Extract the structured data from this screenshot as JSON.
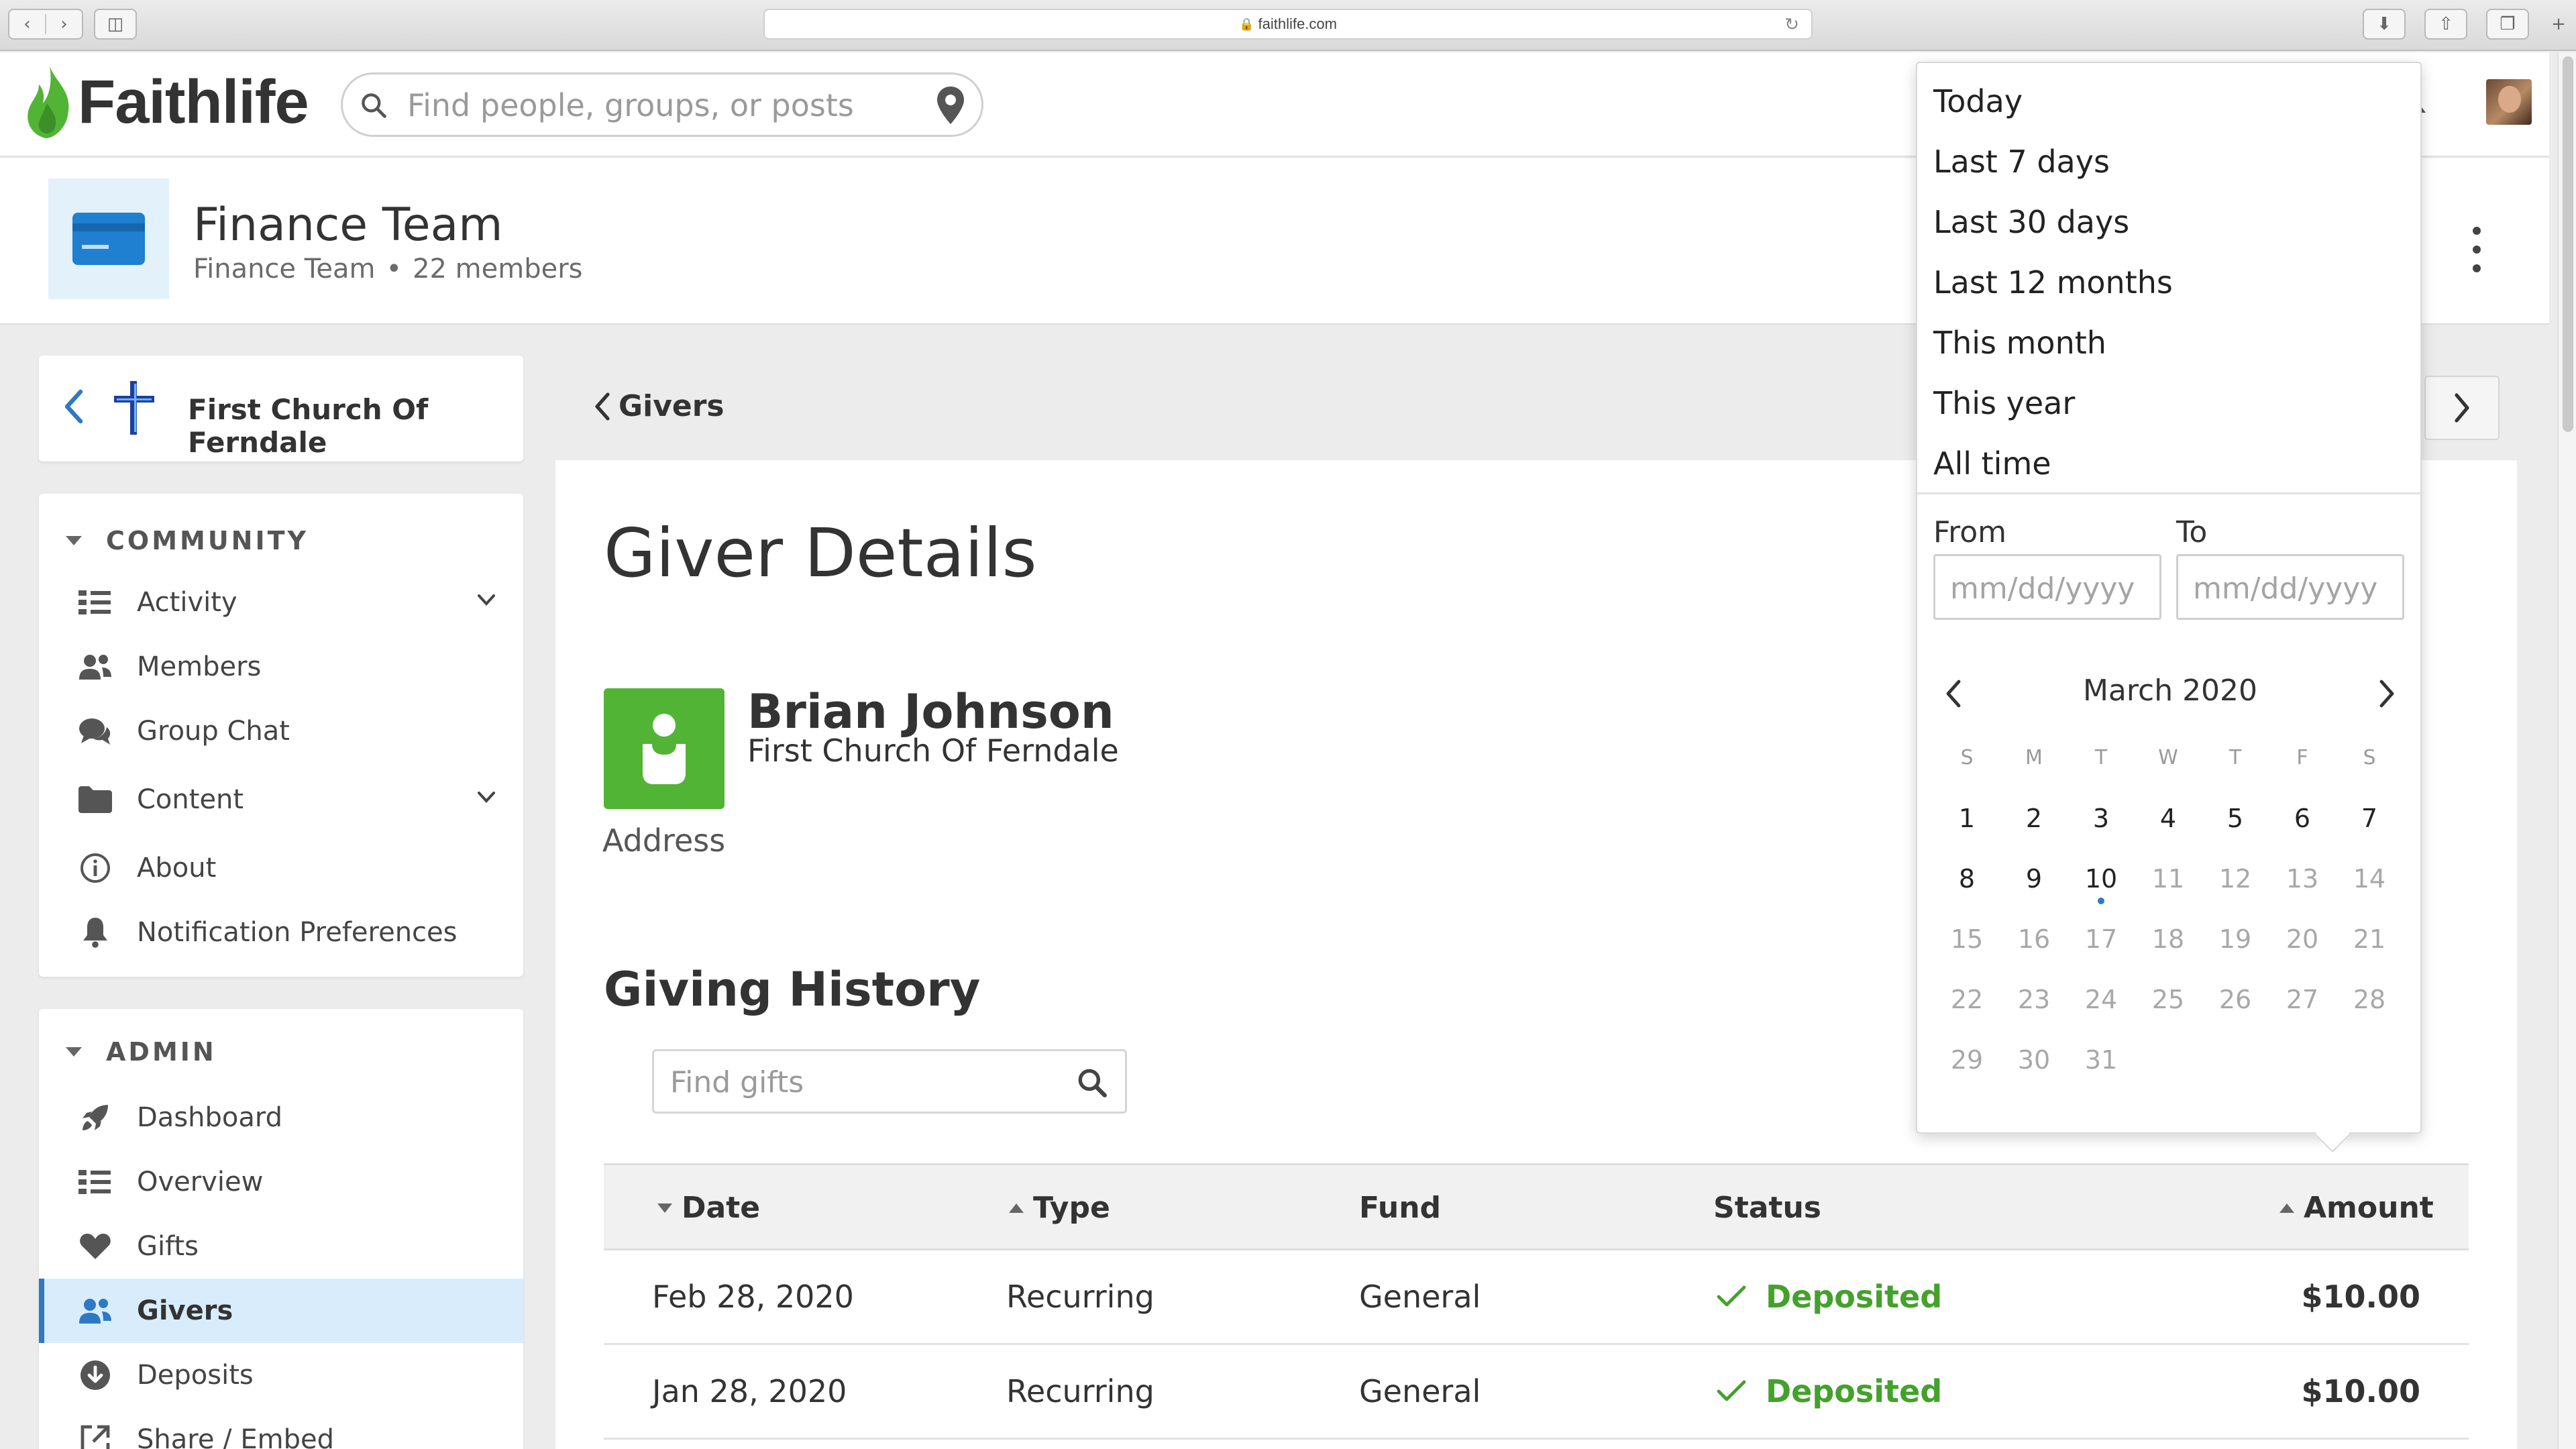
{
  "browser": {
    "url": "faithlife.com"
  },
  "header": {
    "logo_text": "Faithlife",
    "search_placeholder": "Find people, groups, or posts"
  },
  "group": {
    "name": "Finance Team",
    "subtitle_name": "Finance Team",
    "members": "22 members"
  },
  "sidebar": {
    "church": "First Church Of Ferndale",
    "community_title": "COMMUNITY",
    "community_items": [
      {
        "label": "Activity",
        "icon": "list-icon"
      },
      {
        "label": "Members",
        "icon": "people-icon"
      },
      {
        "label": "Group Chat",
        "icon": "chat-icon"
      },
      {
        "label": "Content",
        "icon": "folder-icon"
      },
      {
        "label": "About",
        "icon": "info-icon"
      },
      {
        "label": "Notification Preferences",
        "icon": "bell-icon"
      }
    ],
    "admin_title": "ADMIN",
    "admin_items": [
      {
        "label": "Dashboard",
        "icon": "rocket-icon"
      },
      {
        "label": "Overview",
        "icon": "list-icon"
      },
      {
        "label": "Gifts",
        "icon": "heart-icon"
      },
      {
        "label": "Givers",
        "icon": "people-icon",
        "active": true
      },
      {
        "label": "Deposits",
        "icon": "download-icon"
      },
      {
        "label": "Share / Embed",
        "icon": "share-icon"
      }
    ]
  },
  "main": {
    "back_label": "Givers",
    "title": "Giver Details",
    "giver": {
      "name": "Brian Johnson",
      "church": "First Church Of Ferndale",
      "address_label": "Address"
    },
    "history_title": "Giving History",
    "find_placeholder": "Find gifts",
    "columns": [
      "Date",
      "Type",
      "Fund",
      "Status",
      "Amount"
    ],
    "rows": [
      {
        "date": "Feb 28, 2020",
        "type": "Recurring",
        "fund": "General",
        "status": "Deposited",
        "amount": "$10.00"
      },
      {
        "date": "Jan 28, 2020",
        "type": "Recurring",
        "fund": "General",
        "status": "Deposited",
        "amount": "$10.00"
      }
    ]
  },
  "dropdown": {
    "presets": [
      "Today",
      "Last 7 days",
      "Last 30 days",
      "Last 12 months",
      "This month",
      "This year",
      "All time"
    ],
    "from_label": "From",
    "to_label": "To",
    "date_placeholder": "mm/dd/yyyy",
    "month": "March 2020",
    "weekdays": [
      "S",
      "M",
      "T",
      "W",
      "T",
      "F",
      "S"
    ],
    "days": [
      [
        "1",
        "2",
        "3",
        "4",
        "5",
        "6",
        "7"
      ],
      [
        "8",
        "9",
        "10",
        "11",
        "12",
        "13",
        "14"
      ],
      [
        "15",
        "16",
        "17",
        "18",
        "19",
        "20",
        "21"
      ],
      [
        "22",
        "23",
        "24",
        "25",
        "26",
        "27",
        "28"
      ],
      [
        "29",
        "30",
        "31"
      ]
    ],
    "today": "10"
  },
  "colors": {
    "brand_green": "#52b435",
    "accent_blue": "#2e79c5",
    "status_green": "#43a12c"
  }
}
